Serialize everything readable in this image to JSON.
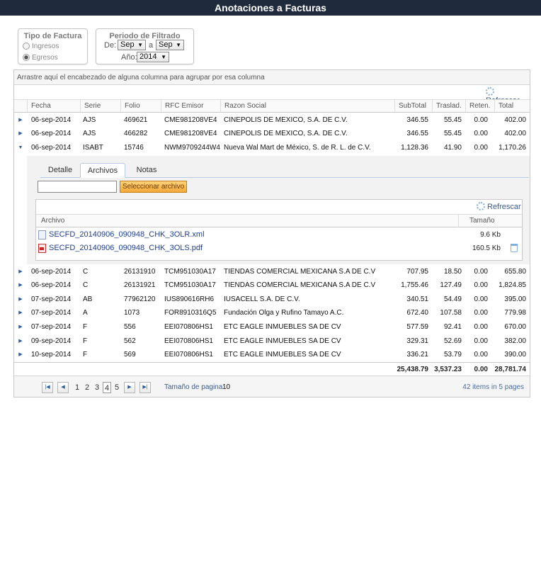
{
  "app": {
    "title": "Anotaciones a Facturas"
  },
  "filter_tipo": {
    "legend": "Tipo de Factura",
    "options": [
      {
        "label": "Ingresos",
        "selected": false
      },
      {
        "label": "Egresos",
        "selected": true
      }
    ]
  },
  "filter_periodo": {
    "legend": "Periodo de Filtrado",
    "de_label": "De:",
    "de_value": "Sep",
    "a_label": "a",
    "a_value": "Sep",
    "anio_label": "Año:",
    "anio_value": "2014"
  },
  "grid": {
    "group_hint": "Arrastre aquí el encabezado de alguna columna para agrupar por esa columna",
    "refresh_label": "Refrescar",
    "columns": [
      "Fecha",
      "Serie",
      "Folio",
      "RFC Emisor",
      "Razon Social",
      "SubTotal",
      "Traslad.",
      "Reten.",
      "Total"
    ],
    "rows": [
      {
        "fecha": "06-sep-2014",
        "serie": "AJS",
        "folio": "469621",
        "rfc": "CME981208VE4",
        "razon": "CINEPOLIS DE MEXICO, S.A. DE C.V.",
        "subtotal": "346.55",
        "traslad": "55.45",
        "reten": "0.00",
        "total": "402.00",
        "expanded": false
      },
      {
        "fecha": "06-sep-2014",
        "serie": "AJS",
        "folio": "466282",
        "rfc": "CME981208VE4",
        "razon": "CINEPOLIS DE MEXICO, S.A. DE C.V.",
        "subtotal": "346.55",
        "traslad": "55.45",
        "reten": "0.00",
        "total": "402.00",
        "expanded": false
      },
      {
        "fecha": "06-sep-2014",
        "serie": "ISABT",
        "folio": "15746",
        "rfc": "NWM9709244W4",
        "razon": "Nueva Wal Mart de México, S. de R. L. de C.V.",
        "subtotal": "1,128.36",
        "traslad": "41.90",
        "reten": "0.00",
        "total": "1,170.26",
        "expanded": true
      },
      {
        "fecha": "06-sep-2014",
        "serie": "C",
        "folio": "26131910",
        "rfc": "TCM951030A17",
        "razon": "TIENDAS COMERCIAL MEXICANA S.A DE C.V",
        "subtotal": "707.95",
        "traslad": "18.50",
        "reten": "0.00",
        "total": "655.80",
        "expanded": false
      },
      {
        "fecha": "06-sep-2014",
        "serie": "C",
        "folio": "26131921",
        "rfc": "TCM951030A17",
        "razon": "TIENDAS COMERCIAL MEXICANA S.A DE C.V",
        "subtotal": "1,755.46",
        "traslad": "127.49",
        "reten": "0.00",
        "total": "1,824.85",
        "expanded": false
      },
      {
        "fecha": "07-sep-2014",
        "serie": "AB",
        "folio": "77962120",
        "rfc": "IUS890616RH6",
        "razon": "IUSACELL S.A. DE C.V.",
        "subtotal": "340.51",
        "traslad": "54.49",
        "reten": "0.00",
        "total": "395.00",
        "expanded": false
      },
      {
        "fecha": "07-sep-2014",
        "serie": "A",
        "folio": "1073",
        "rfc": "FOR8910316Q5",
        "razon": "Fundación Olga y Rufino Tamayo A.C.",
        "subtotal": "672.40",
        "traslad": "107.58",
        "reten": "0.00",
        "total": "779.98",
        "expanded": false
      },
      {
        "fecha": "07-sep-2014",
        "serie": "F",
        "folio": "556",
        "rfc": "EEI070806HS1",
        "razon": "ETC EAGLE INMUEBLES SA DE CV",
        "subtotal": "577.59",
        "traslad": "92.41",
        "reten": "0.00",
        "total": "670.00",
        "expanded": false
      },
      {
        "fecha": "09-sep-2014",
        "serie": "F",
        "folio": "562",
        "rfc": "EEI070806HS1",
        "razon": "ETC EAGLE INMUEBLES SA DE CV",
        "subtotal": "329.31",
        "traslad": "52.69",
        "reten": "0.00",
        "total": "382.00",
        "expanded": false
      },
      {
        "fecha": "10-sep-2014",
        "serie": "F",
        "folio": "569",
        "rfc": "EEI070806HS1",
        "razon": "ETC EAGLE INMUEBLES SA DE CV",
        "subtotal": "336.21",
        "traslad": "53.79",
        "reten": "0.00",
        "total": "390.00",
        "expanded": false
      }
    ],
    "totals": {
      "subtotal": "25,438.79",
      "traslad": "3,537.23",
      "reten": "0.00",
      "total": "28,781.74"
    }
  },
  "detail": {
    "tabs": [
      {
        "label": "Detalle",
        "active": false
      },
      {
        "label": "Archivos",
        "active": true
      },
      {
        "label": "Notas",
        "active": false
      }
    ],
    "upload_button": "Seleccionar archivo",
    "refresh_label": "Refrescar",
    "columns": [
      "Archivo",
      "Tamaño"
    ],
    "files": [
      {
        "name": "SECFD_20140906_090948_CHK_3OLR.xml",
        "size": "9.6 Kb",
        "type": "xml",
        "icon": "xml-file-icon"
      },
      {
        "name": "SECFD_20140906_090948_CHK_3OLS.pdf",
        "size": "160.5 Kb",
        "type": "pdf",
        "icon": "pdf-file-icon"
      }
    ]
  },
  "pager": {
    "pages": [
      "1",
      "2",
      "3",
      "4",
      "5"
    ],
    "current_page": "4",
    "page_size_label": "Tamaño de pagina",
    "page_size": "10",
    "info": "42 items in 5 pages"
  }
}
